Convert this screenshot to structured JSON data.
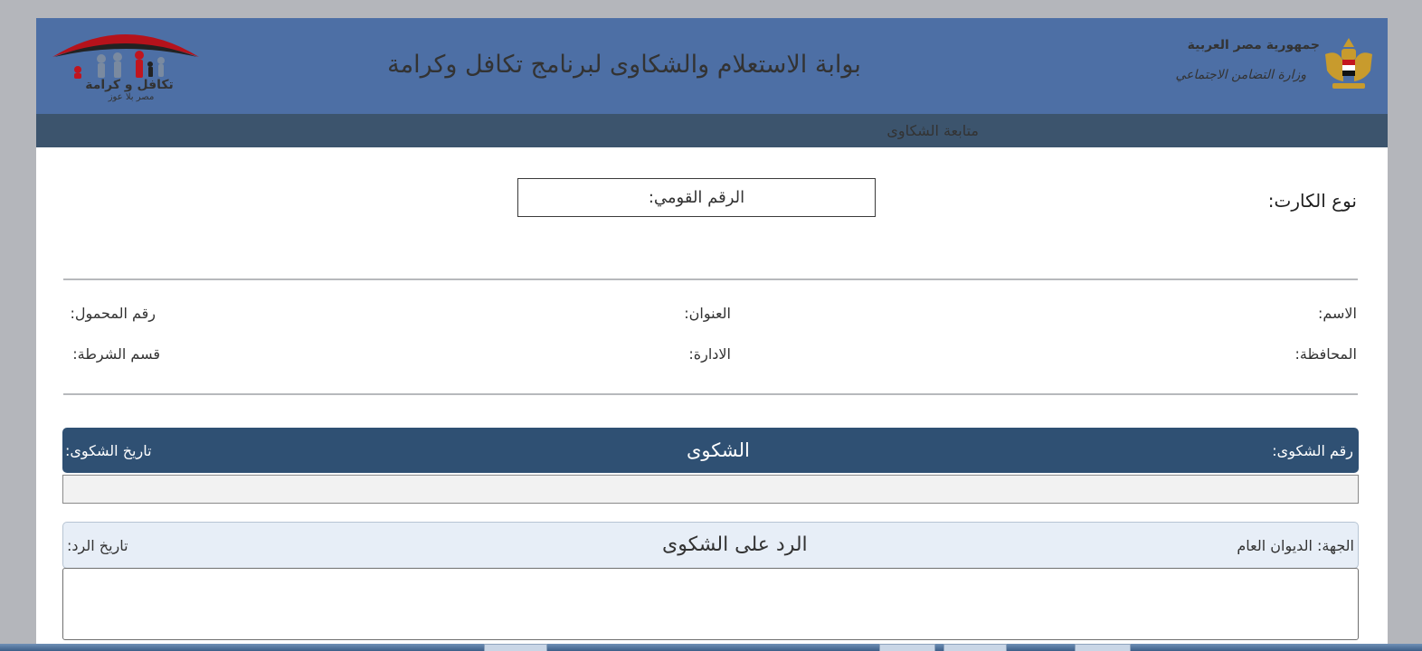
{
  "header": {
    "title": "بوابة الاستعلام والشكاوى لبرنامج تكافل وكرامة",
    "gov_name": "جمهورية مصر العربية",
    "ministry": "وزارة التضامن الاجتماعي",
    "logo_text": "تكافل و كرامة",
    "logo_tagline": "مصر بلا عوز"
  },
  "subheader": {
    "title": "متابعة الشكاوى"
  },
  "search": {
    "card_type_label": "نوع الكارت:",
    "national_id_placeholder": "الرقم القومي:"
  },
  "info": {
    "name": "الاسم:",
    "address": "العنوان:",
    "mobile": "رقم المحمول:",
    "governorate": "المحافظة:",
    "administration": "الادارة:",
    "police_section": "قسم الشرطة:"
  },
  "complaint": {
    "number_label": "رقم الشكوى:",
    "title": "الشكوى",
    "date_label": "تاريخ الشكوى:"
  },
  "reply": {
    "entity_label": "الجهة:",
    "entity_value": "الديوان العام",
    "title": "الرد على الشكوى",
    "date_label": "تاريخ الرد:"
  },
  "colors": {
    "header": "#4d6fa5",
    "subheader": "#3c546d",
    "panel": "#2f5073",
    "reply_panel": "#e7eef7"
  }
}
